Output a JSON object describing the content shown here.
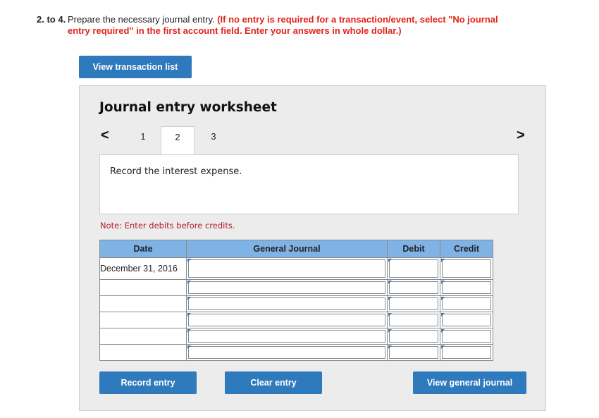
{
  "question": {
    "number": "2. to 4.",
    "lead": "Prepare the necessary journal entry.",
    "instruction": "(If no entry is required for a transaction/event, select \"No journal entry required\" in the first account field. Enter your answers in whole dollar.)"
  },
  "buttons": {
    "view_transactions": "View transaction list",
    "record_entry": "Record entry",
    "clear_entry": "Clear entry",
    "view_general_journal": "View general journal"
  },
  "worksheet": {
    "title": "Journal entry worksheet",
    "prev_icon": "chevron-left-icon",
    "next_icon": "chevron-right-icon",
    "prev_glyph": "<",
    "next_glyph": ">",
    "tabs": [
      "1",
      "2",
      "3"
    ],
    "active_tab": "2",
    "description": "Record the interest expense.",
    "note": "Note: Enter debits before credits."
  },
  "journal": {
    "headers": {
      "date": "Date",
      "account": "General Journal",
      "debit": "Debit",
      "credit": "Credit"
    },
    "rows": [
      {
        "date": "December 31, 2016",
        "account": "",
        "debit": "",
        "credit": ""
      },
      {
        "date": "",
        "account": "",
        "debit": "",
        "credit": ""
      },
      {
        "date": "",
        "account": "",
        "debit": "",
        "credit": ""
      },
      {
        "date": "",
        "account": "",
        "debit": "",
        "credit": ""
      },
      {
        "date": "",
        "account": "",
        "debit": "",
        "credit": ""
      },
      {
        "date": "",
        "account": "",
        "debit": "",
        "credit": ""
      }
    ]
  },
  "colors": {
    "accent": "#2f79bd",
    "header_fill": "#7fb3e6",
    "warning": "#e2231a",
    "note": "#b3202a"
  }
}
